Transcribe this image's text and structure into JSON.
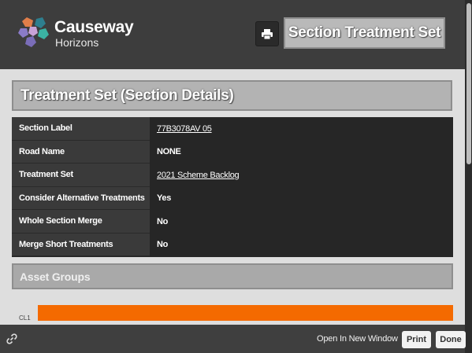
{
  "brand": {
    "name": "Causeway",
    "sub": "Horizons"
  },
  "header": {
    "title": "Section Treatment Set",
    "print_icon": "printer-icon"
  },
  "section": {
    "title": "Treatment Set (Section Details)"
  },
  "details": [
    {
      "label": "Section Label",
      "value": "77B3078AV 05"
    },
    {
      "label": "Road Name",
      "value": "NONE"
    },
    {
      "label": "Treatment Set",
      "value": "2021 Scheme Backlog"
    },
    {
      "label": "Consider Alternative Treatments",
      "value": "Yes"
    },
    {
      "label": "Whole Section Merge",
      "value": "No"
    },
    {
      "label": "Merge Short Treatments",
      "value": "No"
    }
  ],
  "asset_groups": {
    "title": "Asset Groups",
    "row_label": "CL1",
    "bar_color": "#f46a00"
  },
  "footer": {
    "open_new_window": "Open In New Window",
    "print": "Print",
    "done": "Done",
    "link_icon": "link-icon"
  }
}
